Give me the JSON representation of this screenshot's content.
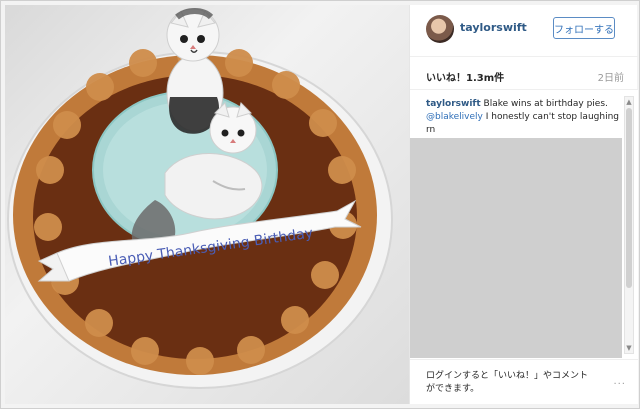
{
  "post": {
    "username": "taylorswift",
    "follow_label": "フォローする",
    "likes_label": "いいね！1.3m件",
    "time_label": "2日前",
    "caption_user": "taylorswift",
    "caption_text": "Blake wins at birthday pies.",
    "caption_mention": "@blakelively",
    "caption_more": "I honestly can't stop laughing rn"
  },
  "photo": {
    "banner_text": "Happy Thanksgiving Birthday",
    "colors": {
      "pie_crust": "#c07a3a",
      "pie_fill": "#6a2f12",
      "plate": "#a9d6d4"
    }
  },
  "footer": {
    "login_text": "ログインすると「いいね！」やコメントができます。",
    "more_icon": "..."
  },
  "icons": {
    "avatar": "profile-avatar-icon",
    "scroll_up": "chevron-up-icon",
    "scroll_down": "chevron-down-icon"
  }
}
